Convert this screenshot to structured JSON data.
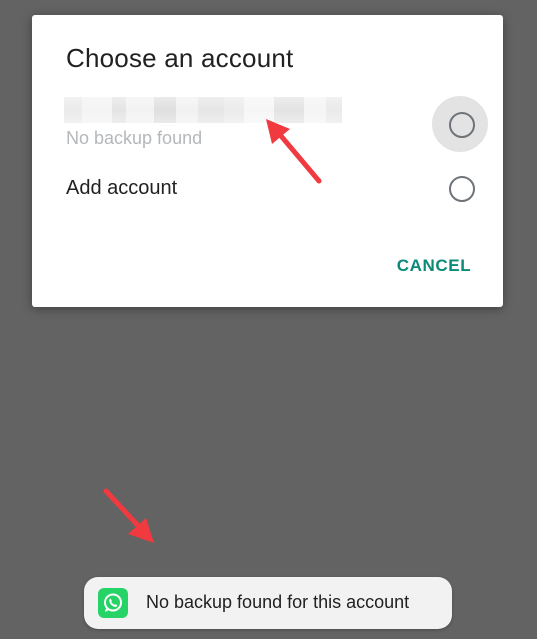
{
  "dialog": {
    "title": "Choose an account",
    "options": [
      {
        "subtext": "No backup found",
        "selected": false,
        "email_redacted": true
      },
      {
        "label": "Add account",
        "selected": false
      }
    ],
    "cancel_label": "CANCEL"
  },
  "toast": {
    "icon": "whatsapp-icon",
    "message": "No backup found for this account"
  },
  "colors": {
    "scrim": "#636363",
    "accent": "#0b8a77",
    "whatsapp_green": "#25d366",
    "annotation_arrow": "#f03a3f"
  }
}
